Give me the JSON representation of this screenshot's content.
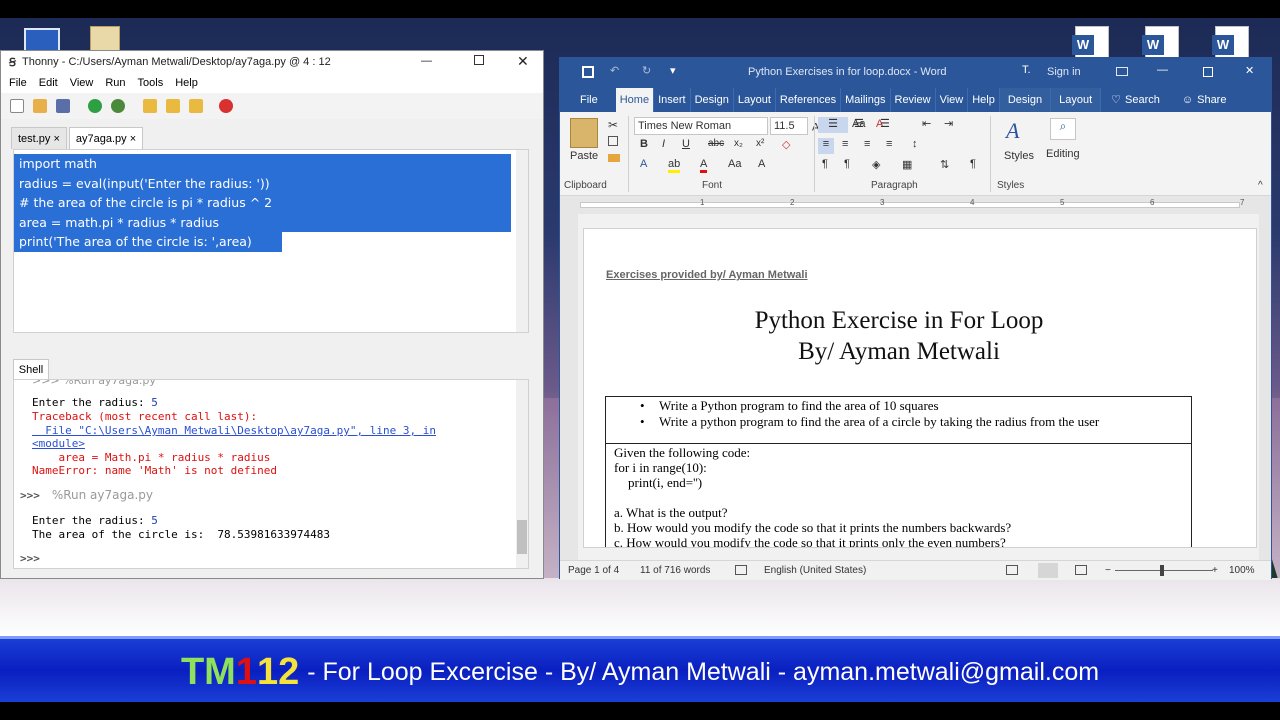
{
  "thonny": {
    "title": "Thonny  -  C:/Users/Ayman Metwali/Desktop/ay7aga.py  @  4 : 12",
    "menu": [
      "File",
      "Edit",
      "View",
      "Run",
      "Tools",
      "Help"
    ],
    "tabs": [
      "test.py  ×",
      "ay7aga.py  ×"
    ],
    "code": [
      "import math",
      "radius = eval(input('Enter the radius: '))",
      "# the area of the circle is pi * radius ^ 2",
      "area = math.pi * radius * radius",
      "print('The area of the circle is: ',area)"
    ],
    "shell_label": "Shell",
    "shell": {
      "cut_top": ">>> %Run ay7aga.py",
      "l1a": "Enter the radius: ",
      "l1b": "5",
      "tb1": "Traceback (most recent call last):",
      "tb2": "  File \"C:\\Users\\Ayman Metwali\\Desktop\\ay7aga.py\", line 3, in",
      "tb3": "<module>",
      "tb4": "    area = Math.pi * radius * radius",
      "tb5": "NameError: name 'Math' is not defined",
      "prompt1": ">>>",
      "run2": " %Run ay7aga.py",
      "l2a": "Enter the radius: ",
      "l2b": "5",
      "result": "The area of the circle is:  78.53981633974483",
      "prompt2": ">>>"
    }
  },
  "word": {
    "title": "Python Exercises in for loop.docx  -  Word",
    "signin": "Sign in",
    "tabs": [
      "File",
      "Home",
      "Insert",
      "Design",
      "Layout",
      "References",
      "Mailings",
      "Review",
      "View",
      "Help",
      "Design",
      "Layout"
    ],
    "search": "Search",
    "share": "Share",
    "font_name": "Times New Roman",
    "font_size": "11.5",
    "groups": {
      "clipboard": "Clipboard",
      "font": "Font",
      "paragraph": "Paragraph",
      "styles": "Styles"
    },
    "paste": "Paste",
    "styles_btn": "Styles",
    "editing_btn": "Editing",
    "ruler": [
      "1",
      "2",
      "3",
      "4",
      "5",
      "6",
      "7"
    ],
    "doc": {
      "provided": "Exercises provided by/ Ayman Metwali",
      "title1": "Python Exercise in For Loop",
      "title2": "By/ Ayman Metwali",
      "bullet1": "Write a Python program to find the area of 10 squares",
      "bullet2": "Write a python program to find the area of a circle by taking the radius from the user",
      "code_intro": "Given the following code:",
      "code1": "for i in range(10):",
      "code2": "print(i, end='')",
      "qa": "a. What is the output?",
      "qb": "b. How would you modify the code so that it prints the numbers backwards?",
      "qc": "c. How would you modify the code so that it prints only the even numbers?"
    },
    "status": {
      "page": "Page 1 of 4",
      "words": "11 of 716 words",
      "lang": "English (United States)",
      "zoom": "100%"
    }
  },
  "banner": {
    "tm": "TM",
    "one": "1",
    "twelve": "12",
    "rest": "- For Loop Excercise - By/ Ayman Metwali - ayman.metwali@gmail.com"
  },
  "colors": {
    "selection": "#2a6fd6",
    "word_blue": "#2b579a",
    "banner_blue": "#0a1fc0",
    "tm_green": "#8fe05a",
    "one_red": "#e01010",
    "twelve_yellow": "#f5e23a"
  }
}
